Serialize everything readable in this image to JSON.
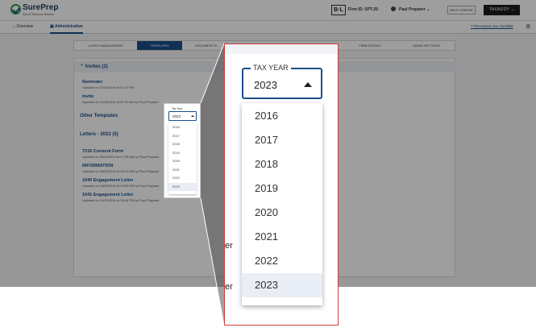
{
  "app": {
    "logo_text": "SurePrep",
    "logo_sub": "Part of Thomson Reuters",
    "firm_badge": "B·L",
    "firm_id": "Firm ID: SPT-29",
    "user_name": "Paul Preparer",
    "help_label": "HELP CENTER",
    "taxaddy_label": "TAXADDY"
  },
  "subnav": {
    "overview": "Overview",
    "administrative": "Administrative",
    "checklist": "Pre-season tax checklist"
  },
  "tabs": [
    "CLIENT MANAGEMENT",
    "TEMPLATES",
    "DOCUMENT R...",
    "...",
    "...S",
    "FIRM DETAILS",
    "ADMIN SETTINGS"
  ],
  "active_tab": 1,
  "panel": {
    "invites_head": "Invites (2)",
    "invites": [
      {
        "title": "Reminder",
        "sub": "Updated on 12/06/2018 at 01:40 PM"
      },
      {
        "title": "Invite",
        "sub": "Updated on 11/15/2022 at 05:31 AM by Paul Preparer"
      }
    ],
    "other_head": "Other Templates",
    "letters_head": "Letters - 2023  (5)",
    "letters": [
      {
        "title": "7216 Consent Form",
        "sub": "Updated on 05/22/2024 at 07:35 AM by Paul Preparer"
      },
      {
        "title": "INFORMATION",
        "sub": "Updated on 05/22/2024 at 05:31 AM by Paul Preparer"
      },
      {
        "title": "1040 Engagement Letter",
        "sub": "Updated on 10/04/2024 at 02:03 PM by Paul Preparer"
      },
      {
        "title": "1041 Engagement Letter",
        "sub": "Updated on 10/07/2024 at 08:44 PM by Paul Preparer"
      }
    ]
  },
  "dropdown": {
    "legend": "TAX YEAR",
    "mini_legend": "Tax Year",
    "selected": "2023",
    "options": [
      "2016",
      "2017",
      "2018",
      "2019",
      "2020",
      "2021",
      "2022",
      "2023"
    ],
    "selected_index": 7
  },
  "zoom_background_letters": [
    "er",
    "er",
    "er",
    "er"
  ],
  "colors": {
    "brand": "#1b4f8a",
    "highlight_border": "#d23a3a",
    "selected_row": "#e9eef6"
  }
}
